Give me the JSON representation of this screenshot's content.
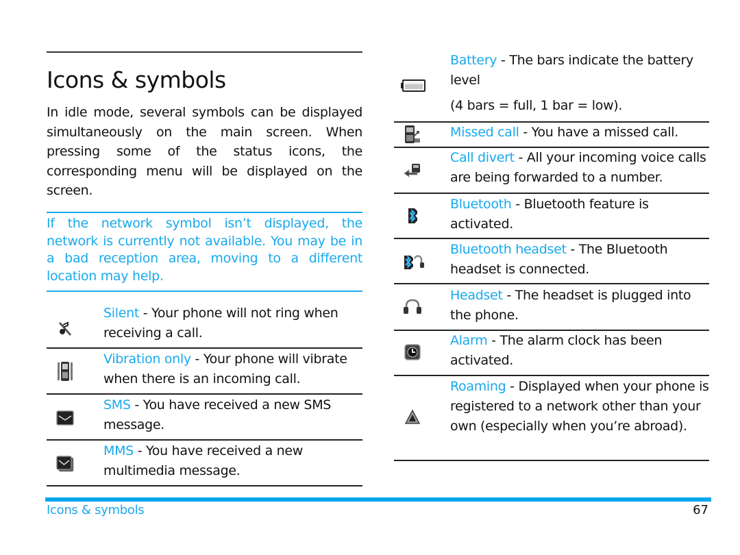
{
  "page": {
    "title": "Icons & symbols",
    "intro": "In idle mode, several symbols can be displayed simultaneously on the main screen.  When pressing some of the status icons, the corresponding menu will be displayed on the screen.",
    "note": "If the network symbol isn’t displayed, the network is currently not available. You may be in a bad reception area, moving to a different location may help.",
    "accent_color": "#19a9ec"
  },
  "left_items": [
    {
      "icon": "silent-icon",
      "term": "Silent",
      "desc": " - Your phone will not ring when receiving a call."
    },
    {
      "icon": "vibration-icon",
      "term": "Vibration only",
      "desc": " - Your phone will vibrate when there is an incoming call."
    },
    {
      "icon": "sms-icon",
      "term": "SMS",
      "desc": " - You have received a new SMS message."
    },
    {
      "icon": "mms-icon",
      "term": "MMS",
      "desc": " - You have received a new multimedia message."
    }
  ],
  "right_items": [
    {
      "icon": "battery-icon",
      "term": "Battery",
      "desc": " - The bars indicate the battery level",
      "extra": "(4 bars = full, 1 bar = low)."
    },
    {
      "icon": "missed-call-icon",
      "term": "Missed call",
      "desc": " - You have a missed call."
    },
    {
      "icon": "call-divert-icon",
      "term": "Call divert",
      "desc": " - All your incoming voice calls are being forwarded to a number."
    },
    {
      "icon": "bluetooth-icon",
      "term": "Bluetooth",
      "desc": " - Bluetooth feature is activated."
    },
    {
      "icon": "bluetooth-headset-icon",
      "term": "Bluetooth headset",
      "desc": " - The Bluetooth headset is connected."
    },
    {
      "icon": "headset-icon",
      "term": "Headset",
      "desc": " - The headset is plugged into the phone."
    },
    {
      "icon": "alarm-icon",
      "term": "Alarm",
      "desc": " - The alarm clock has been activated."
    },
    {
      "icon": "roaming-icon",
      "term": "Roaming",
      "desc": " - Displayed when your phone is registered to a network other than your own (especially when you’re abroad)."
    }
  ],
  "footer": {
    "section": "Icons & symbols",
    "page_number": "67"
  }
}
